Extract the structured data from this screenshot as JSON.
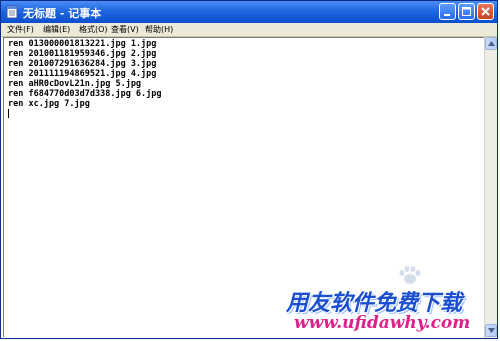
{
  "window": {
    "title": "无标题 - 记事本"
  },
  "menu": {
    "items": [
      {
        "label": "文件(F)"
      },
      {
        "label": "编辑(E)"
      },
      {
        "label": "格式(O)"
      },
      {
        "label": "查看(V)"
      },
      {
        "label": "帮助(H)"
      }
    ]
  },
  "editor": {
    "lines": [
      "ren 013000001813221.jpg 1.jpg",
      "ren 201001181959346.jpg 2.jpg",
      "ren 201007291636284.jpg 3.jpg",
      "ren 201111194869521.jpg 4.jpg",
      "ren aHR0cDovL21n.jpg 5.jpg",
      "ren f684770d03d7d338.jpg 6.jpg",
      "ren xc.jpg 7.jpg"
    ]
  },
  "watermark": {
    "title": "用友软件免费下载",
    "url": "www.ufidawhy.com"
  },
  "colors": {
    "titlebar": "#0a4fcf",
    "menubar": "#ece9d8",
    "watermark_title": "#1a4fd0",
    "watermark_url": "#e0208a"
  },
  "icons": [
    "notepad-icon",
    "minimize-icon",
    "maximize-icon",
    "close-icon",
    "scroll-up-icon",
    "scroll-down-icon",
    "baidu-paw-icon"
  ]
}
